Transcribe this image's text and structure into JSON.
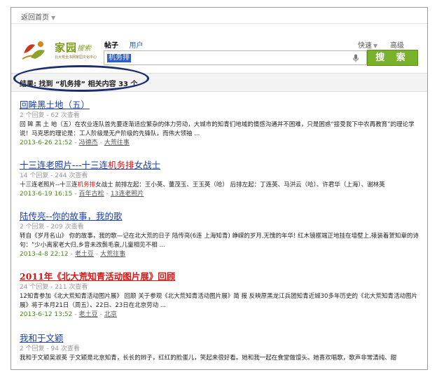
{
  "header": {
    "back_home": "返回首页",
    "tabs": [
      "帖子",
      "用户"
    ],
    "quick": "快速",
    "advanced": "高级"
  },
  "logo": {
    "brand": "家园",
    "sub": "搜索",
    "tagline": "北大荒全书网家园文化中心"
  },
  "search": {
    "value": "机务排",
    "button": "搜 索"
  },
  "result_summary": {
    "text": "结果: 找到 “机务排” 相关内容 33 个"
  },
  "results": [
    {
      "title": "回眸黑土地（五）",
      "meta": "2 个回复 - 62 次查看",
      "snippet": "回 眸 黑 土 地（五）在农业连队首先要逐渐适应繁杂的体力劳动，大城市的知青们地域的情感沟通并不困难，只是困惑“接受我下中农再教育”的理论学说！马克思的理论是：工人阶级是无产阶级的先锋队，而伟大领袖 ...",
      "date": "2013-6-26 21:52",
      "author": "冯德杰",
      "forum": "大荒往事"
    },
    {
      "title_pre": "十三连老照片---十三连",
      "title_hl": "机务排",
      "title_post": "女战士",
      "meta": "14 个回复 - 244 次查看",
      "snippet_pre": "十三连老照片--十三连",
      "snippet_hl": "机务排",
      "snippet_post": "女战士 前排左起：王小英、董茂玉、王玉英（哈） 后排左起：丁连英、马洪云（哈）、许君华（上海）、谢林英",
      "date": "2013-6-19 16:15",
      "author": "百年古松",
      "forum": "13连老照片"
    },
    {
      "title": "陆传亮--你的故事，我的歌",
      "meta": "2 个回复 - 209 次查看",
      "snippet": "转自《岁月名山》 你的故事，我的歌—记在北大荒的日子 陆传亮(6连 上海知青) 峥嵘的岁月,无愧的年华! 红木镜框端正地挂在墙壁上,裱装着贺知章的诗句：“少小离家老大归,乡音未改鬓毛衰,儿童相见不相 ...",
      "date": "2013-4-8 22:12",
      "author": "老土豆",
      "forum": "大荒往事"
    },
    {
      "title": "2011年《北大荒知青活动图片展》回顾",
      "meta": "24 个回复 - 211 次查看",
      "snippet": "12知青参加《北大荒知青活动图片展》 回顾 关于参观《北大荒知青活动图片展》简 报 反映原黑龙江兵团知青近城30多年历史的《北大荒知青活动图片展》将于本月21日（周五）、22日、23日在北京劳动 ...",
      "date": "2013-6-12 13:52",
      "author": "老土豆",
      "forum": "北京"
    },
    {
      "title": "我和于文颖",
      "meta": "2 个回复 - 94 次查看",
      "snippet": "我和于文颖吴淑英 于文颖是北京知青，长长的辫子，红红的脸蛋儿，笑起来很好看。她和我一起在食堂做馒头。她喜欢唱歌，歌声非常清纯、甜"
    }
  ]
}
